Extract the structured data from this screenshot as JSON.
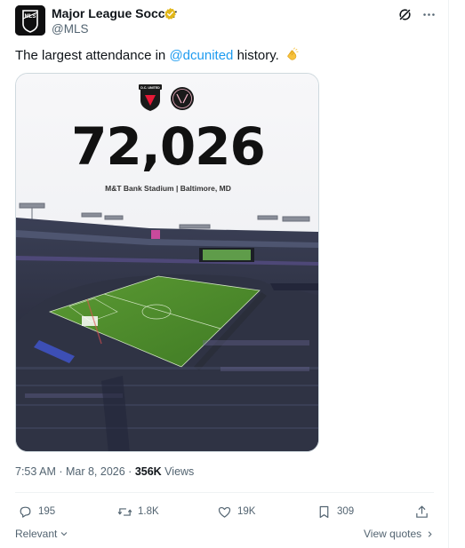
{
  "author": {
    "name": "Major League Soccer",
    "handle": "@MLS",
    "avatar_text": "MLS",
    "verified": true,
    "verified_color": "#e2b719"
  },
  "tweet": {
    "text_before": "The largest attendance in ",
    "mention": "@dcunited",
    "text_after": " history.",
    "emoji": "clapping-hands"
  },
  "media": {
    "team_logo_left": "D.C. UNITED",
    "number": "72,026",
    "venue": "M&T Bank Stadium | Baltimore, MD"
  },
  "meta": {
    "time": "7:53 AM",
    "separator": " · ",
    "date": "Mar 8, 2026",
    "views_count": "356K",
    "views_label": " Views"
  },
  "actions": {
    "replies": "195",
    "reposts": "1.8K",
    "likes": "19K",
    "bookmarks": "309"
  },
  "footer": {
    "sort_label": "Relevant",
    "view_quotes_label": "View quotes"
  },
  "colors": {
    "accent": "#1d9bf0",
    "secondary_text": "#536471",
    "pitch_green": "#4a8a2a"
  }
}
